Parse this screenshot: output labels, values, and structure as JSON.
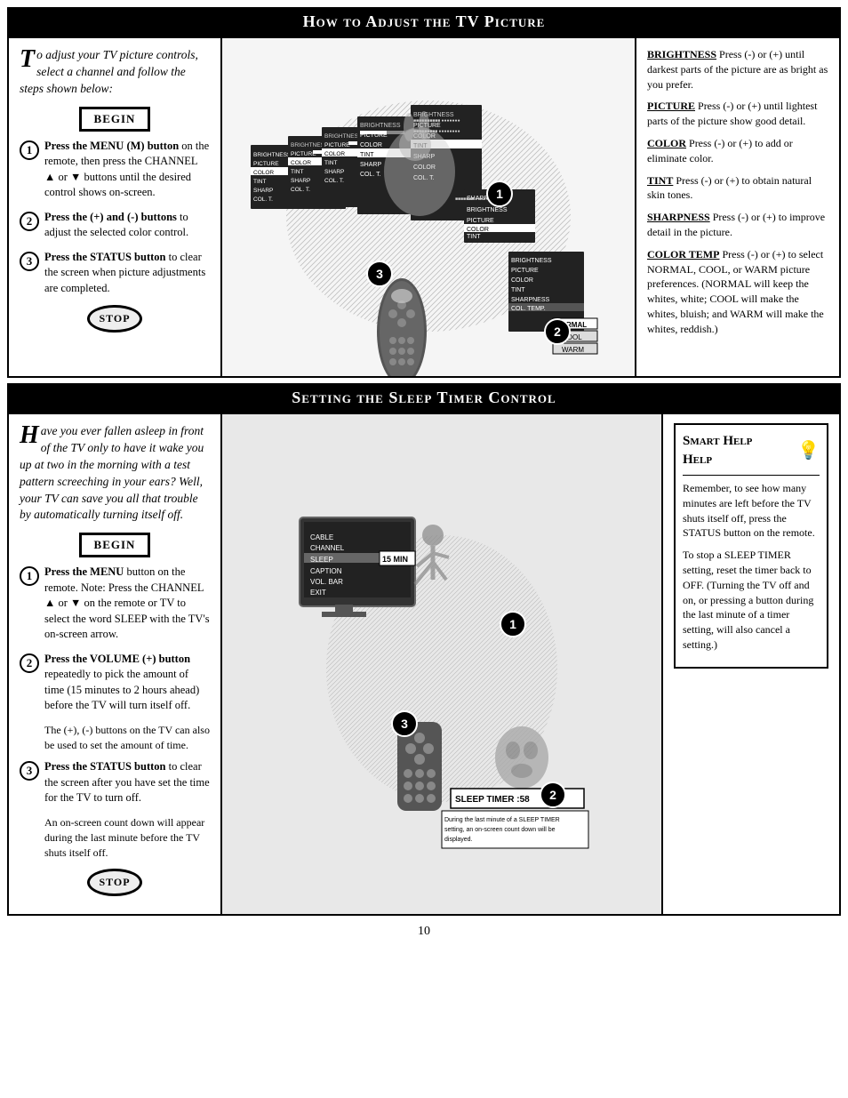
{
  "page": {
    "number": "10"
  },
  "section1": {
    "header": "How to Adjust the TV Picture",
    "intro": "To adjust your TV picture controls, select a channel and follow the steps shown below:",
    "intro_dropcap": "T",
    "begin_label": "BEGIN",
    "stop_label": "STOP",
    "steps": [
      {
        "num": "1",
        "text": "Press the MENU (M) button on the remote, then press the CHANNEL ▲ or ▼ buttons until the desired control shows on-screen."
      },
      {
        "num": "2",
        "text": "Press the (+) and (-) buttons to adjust the selected color control."
      },
      {
        "num": "3",
        "text": "Press the STATUS button to clear the screen when picture adjustments are completed."
      }
    ],
    "notes": [
      {
        "label": "BRIGHTNESS",
        "text": " Press (-) or (+) until darkest parts of the picture are as bright as you prefer."
      },
      {
        "label": "PICTURE",
        "text": " Press (-) or (+) until lightest parts of the picture show good detail."
      },
      {
        "label": "COLOR",
        "text": " Press (-) or (+) to add or eliminate color."
      },
      {
        "label": "TINT",
        "text": " Press (-) or (+) to obtain natural skin tones."
      },
      {
        "label": "SHARPNESS",
        "text": " Press (-) or (+) to improve detail in the picture."
      },
      {
        "label": "COLOR TEMP",
        "text": " Press (-) or (+) to select NORMAL, COOL, or WARM picture preferences. (NORMAL will keep the whites, white; COOL will make the whites, bluish; and WARM will make the whites, reddish.)"
      }
    ],
    "menu_items": [
      "BRIGHTNESS",
      "PICTURE",
      "COLOR",
      "TINT",
      "SHARP",
      "COL. T"
    ],
    "color_temp_options": [
      "NORMAL",
      "COOL",
      "WARM"
    ]
  },
  "section2": {
    "header": "Setting the Sleep Timer Control",
    "intro": "Have you ever fallen asleep in front of the TV only to have it wake you up at two in the morning with a test pattern screeching in your ears?  Well, your TV can save you all that trouble by automatically turning itself off.",
    "intro_dropcap": "H",
    "begin_label": "BEGIN",
    "stop_label": "STOP",
    "steps": [
      {
        "num": "1",
        "text": "Press the MENU button on the remote. Note: Press the CHANNEL ▲ or ▼ on the remote or TV to select the word SLEEP with the TV's on-screen arrow."
      },
      {
        "num": "2",
        "text": "Press the VOLUME (+) button repeatedly to pick the amount of time (15 minutes to 2 hours ahead) before the TV will turn itself off."
      },
      {
        "num": "3",
        "text": "Press the STATUS button to clear the screen after you have set the time for the TV to turn off."
      }
    ],
    "extra_text": [
      "The (+), (-) buttons on the TV can also be used to set the amount of time.",
      "An on-screen count down will appear during the last minute before the TV shuts itself off."
    ],
    "sleep_menu": [
      "CABLE",
      "CHANNEL",
      "SLEEP",
      "CAPTION",
      "VOL. BAR",
      "EXIT"
    ],
    "sleep_time_display": "15 MIN",
    "sleep_timer_label": "SLEEP TIMER :58",
    "countdown_note": "During the last minute of a SLEEP TIMER setting, an on-screen count down will be displayed.",
    "smart_help": {
      "title": "Smart Help",
      "icon": "💡",
      "text1": "Remember, to see how many minutes are left before the TV shuts itself off, press the STATUS button on the remote.",
      "text2": "To stop a SLEEP TIMER setting, reset the timer back to OFF. (Turning the TV off and on, or pressing a button during the last minute of a timer setting, will also cancel a setting.)"
    }
  }
}
